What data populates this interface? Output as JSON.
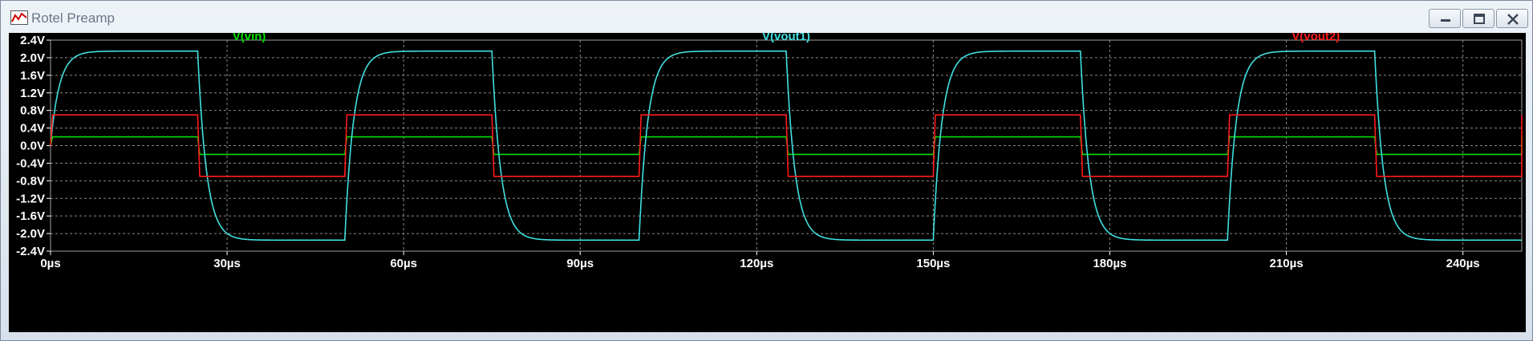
{
  "window": {
    "title": "Rotel Preamp",
    "icon": "waveform-icon",
    "controls": [
      "minimize-icon",
      "maximize-icon",
      "close-icon"
    ]
  },
  "chart_data": {
    "type": "line",
    "title": "",
    "xlabel": "",
    "ylabel": "",
    "xlim": [
      0,
      250
    ],
    "ylim": [
      -2.4,
      2.4
    ],
    "grid": true,
    "background": "#000000",
    "x_ticks": [
      0,
      30,
      60,
      90,
      120,
      150,
      180,
      210,
      240
    ],
    "x_tick_labels": [
      "0µs",
      "30µs",
      "60µs",
      "90µs",
      "120µs",
      "150µs",
      "180µs",
      "210µs",
      "240µs"
    ],
    "y_ticks": [
      2.4,
      2.0,
      1.6,
      1.2,
      0.8,
      0.4,
      0.0,
      -0.4,
      -0.8,
      -1.2,
      -1.6,
      -2.0,
      -2.4
    ],
    "y_tick_labels": [
      "2.4V",
      "2.0V",
      "1.6V",
      "1.2V",
      "0.8V",
      "0.4V",
      "0.0V",
      "-0.4V",
      "-0.8V",
      "-1.2V",
      "-1.6V",
      "-2.0V",
      "-2.4V"
    ],
    "series": [
      {
        "name": "V(vin)",
        "color": "#00e000",
        "waveform": "square",
        "period_us": 50,
        "high": 0.2,
        "low": -0.2
      },
      {
        "name": "V(vout1)",
        "color": "#40e0e0",
        "waveform": "square-rc",
        "period_us": 50,
        "high": 2.15,
        "low": -2.15,
        "time_constant_us": 1.5
      },
      {
        "name": "V(vout2)",
        "color": "#ff1a1a",
        "waveform": "square",
        "period_us": 50,
        "high": 0.7,
        "low": -0.7
      }
    ]
  }
}
